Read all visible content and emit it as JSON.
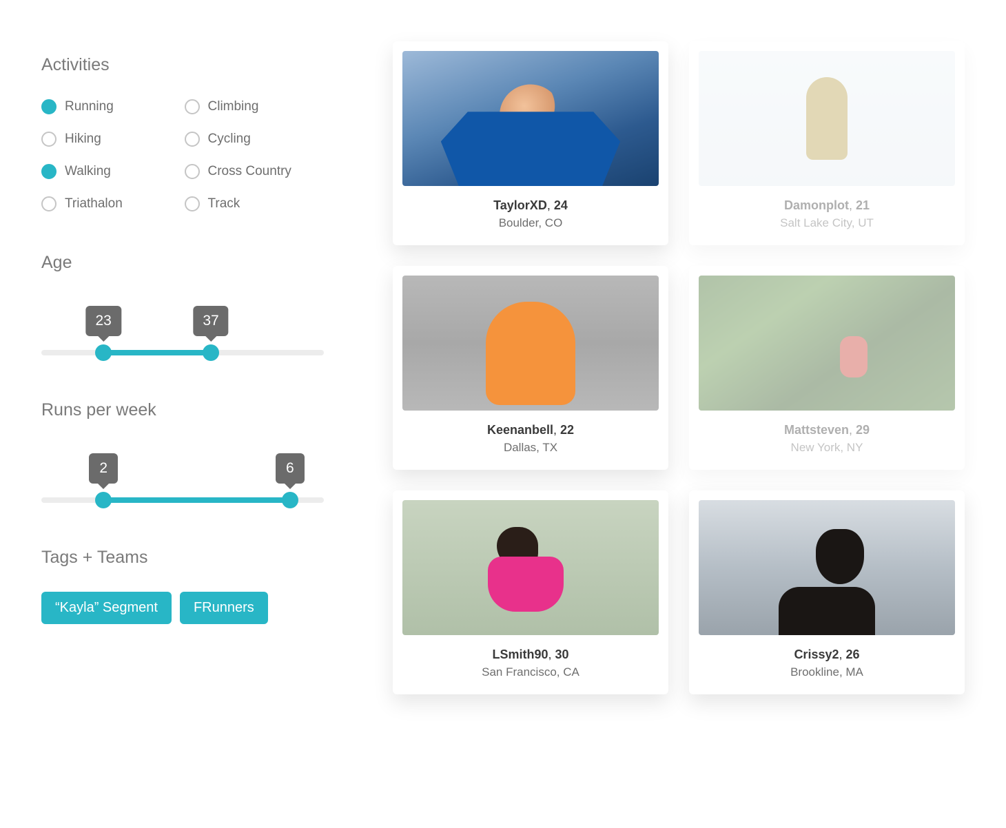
{
  "filters": {
    "activities": {
      "title": "Activities",
      "options": [
        {
          "label": "Running",
          "selected": true
        },
        {
          "label": "Climbing",
          "selected": false
        },
        {
          "label": "Hiking",
          "selected": false
        },
        {
          "label": "Cycling",
          "selected": false
        },
        {
          "label": "Walking",
          "selected": true
        },
        {
          "label": "Cross Country",
          "selected": false
        },
        {
          "label": "Triathalon",
          "selected": false
        },
        {
          "label": "Track",
          "selected": false
        }
      ]
    },
    "age": {
      "title": "Age",
      "min_value": "23",
      "max_value": "37",
      "min_pct": 22,
      "max_pct": 60
    },
    "runs": {
      "title": "Runs per week",
      "min_value": "2",
      "max_value": "6",
      "min_pct": 22,
      "max_pct": 88
    },
    "tags": {
      "title": "Tags + Teams",
      "items": [
        "“Kayla” Segment",
        "FRunners"
      ]
    }
  },
  "results": [
    {
      "username": "TaylorXD",
      "age": "24",
      "location": "Boulder, CO",
      "faded": false,
      "photo": "ph-mountain"
    },
    {
      "username": "Damonplot",
      "age": "21",
      "location": "Salt Lake City, UT",
      "faded": true,
      "photo": "ph-ski"
    },
    {
      "username": "Keenanbell",
      "age": "22",
      "location": "Dallas, TX",
      "faded": false,
      "photo": "ph-hoodie"
    },
    {
      "username": "Mattsteven",
      "age": "29",
      "location": "New York, NY",
      "faded": true,
      "photo": "ph-forest"
    },
    {
      "username": "LSmith90",
      "age": "30",
      "location": "San Francisco, CA",
      "faded": false,
      "photo": "ph-runner"
    },
    {
      "username": "Crissy2",
      "age": "26",
      "location": "Brookline, MA",
      "faded": false,
      "photo": "ph-city"
    }
  ]
}
